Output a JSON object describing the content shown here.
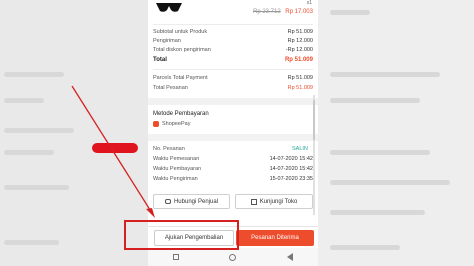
{
  "product": {
    "qty": "x1",
    "price_original": "Rp 23.712",
    "price_discounted": "Rp 17.003"
  },
  "summary": {
    "subtotal_label": "Subtotal untuk Produk",
    "subtotal_value": "Rp 51.009",
    "shipping_label": "Pengiriman",
    "shipping_value": "Rp 12.000",
    "ship_discount_label": "Total diskon pengiriman",
    "ship_discount_value": "-Rp 12.000",
    "total_label": "Total",
    "total_value": "Rp 51.009",
    "parcel_label": "Parcels Total Payment",
    "parcel_value": "Rp 51.009",
    "order_total_label": "Total Pesanan",
    "order_total_value": "Rp 51.009"
  },
  "payment": {
    "title": "Metode Pembayaran",
    "method": "ShopeePay"
  },
  "order_info": {
    "no_label": "No. Pesanan",
    "copy_label": "SALIN",
    "ordered_label": "Waktu Pemesanan",
    "ordered_value": "14-07-2020 15:42",
    "paid_label": "Waktu Pembayaran",
    "paid_value": "14-07-2020 15:42",
    "shipped_label": "Waktu Pengiriman",
    "shipped_value": "15-07-2020 23:35"
  },
  "actions": {
    "contact_seller": "Hubungi Penjual",
    "visit_shop": "Kunjungi Toko",
    "request_return": "Ajukan Pengembalian",
    "order_received": "Pesanan Diterima"
  },
  "colors": {
    "accent": "#ee4d2d",
    "annotation": "#d62020",
    "redaction": "#e0141e",
    "copy": "#26aa99"
  }
}
